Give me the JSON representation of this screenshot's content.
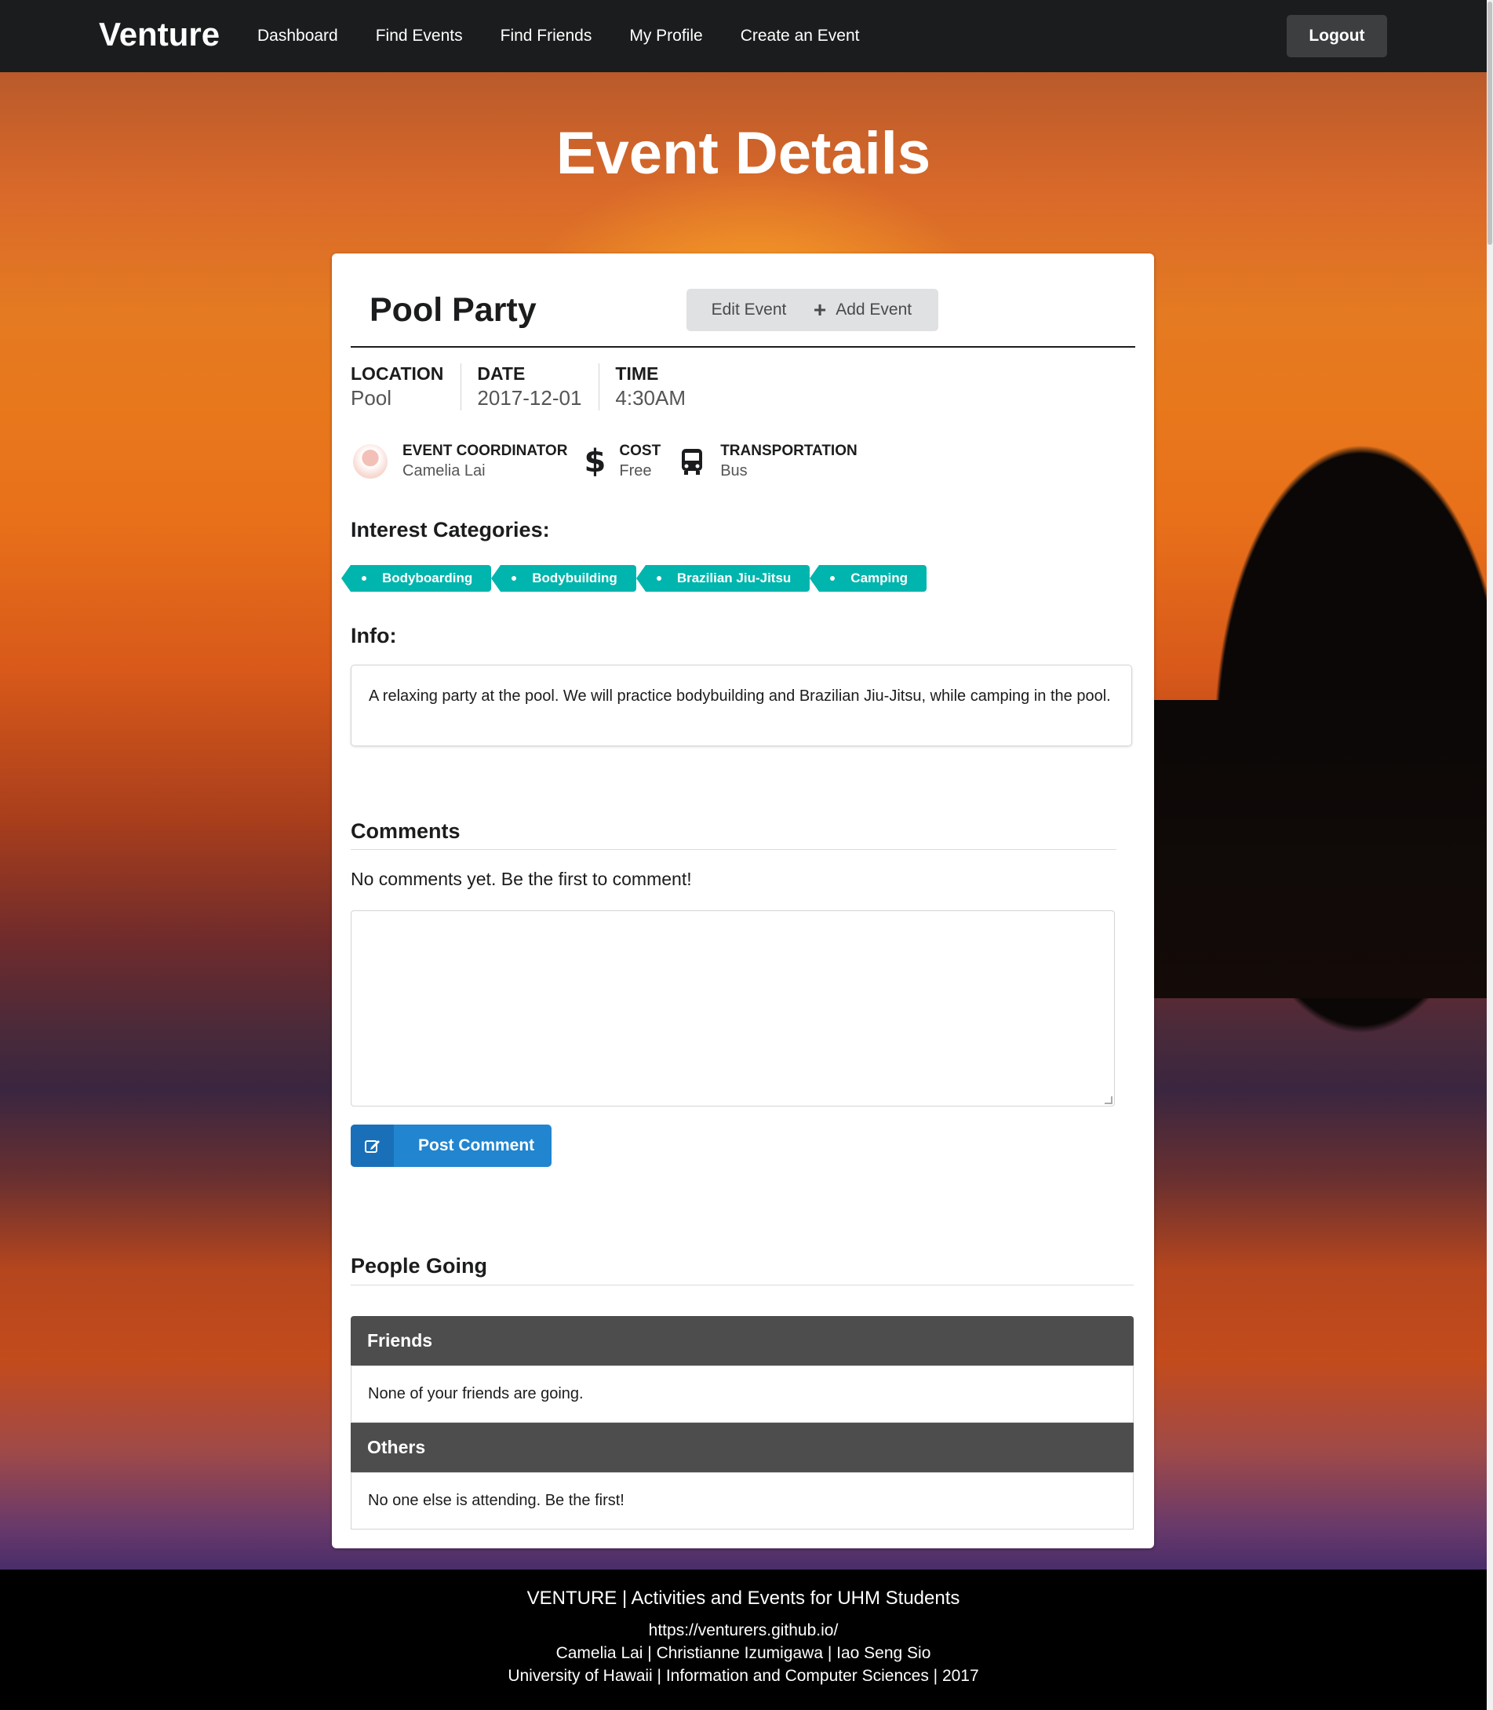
{
  "navbar": {
    "brand": "Venture",
    "items": [
      "Dashboard",
      "Find Events",
      "Find Friends",
      "My Profile",
      "Create an Event"
    ],
    "logout": "Logout"
  },
  "page": {
    "title": "Event Details"
  },
  "event": {
    "name": "Pool Party",
    "edit_label": "Edit Event",
    "add_label": "Add Event",
    "location_label": "LOCATION",
    "location": "Pool",
    "date_label": "DATE",
    "date": "2017-12-01",
    "time_label": "TIME",
    "time": "4:30AM",
    "coordinator_label": "EVENT COORDINATOR",
    "coordinator": "Camelia Lai",
    "cost_label": "COST",
    "cost": "Free",
    "transport_label": "TRANSPORTATION",
    "transport": "Bus",
    "categories_heading": "Interest Categories:",
    "categories": [
      "Bodyboarding",
      "Bodybuilding",
      "Brazilian Jiu-Jitsu",
      "Camping"
    ],
    "info_heading": "Info:",
    "info": "A relaxing party at the pool. We will practice bodybuilding and Brazilian Jiu-Jitsu, while camping in the pool."
  },
  "comments": {
    "heading": "Comments",
    "empty": "No comments yet. Be the first to comment!",
    "post_label": "Post Comment"
  },
  "people": {
    "heading": "People Going",
    "friends_heading": "Friends",
    "friends_empty": "None of your friends are going.",
    "others_heading": "Others",
    "others_empty": "No one else is attending. Be the first!"
  },
  "footer": {
    "line1": "VENTURE | Activities and Events for UHM Students",
    "line2": "https://venturers.github.io/",
    "line3": "Camelia Lai | Christianne Izumigawa | Iao Seng Sio",
    "line4": "University of Hawaii | Information and Computer Sciences | 2017"
  },
  "colors": {
    "navbar": "#1b1c1d",
    "tag": "#00b5ad",
    "primary": "#2185d0",
    "group_header": "#4d4d4e"
  },
  "icons": [
    "avatar",
    "dollar-icon",
    "bus-icon",
    "plus-icon",
    "edit-icon"
  ]
}
